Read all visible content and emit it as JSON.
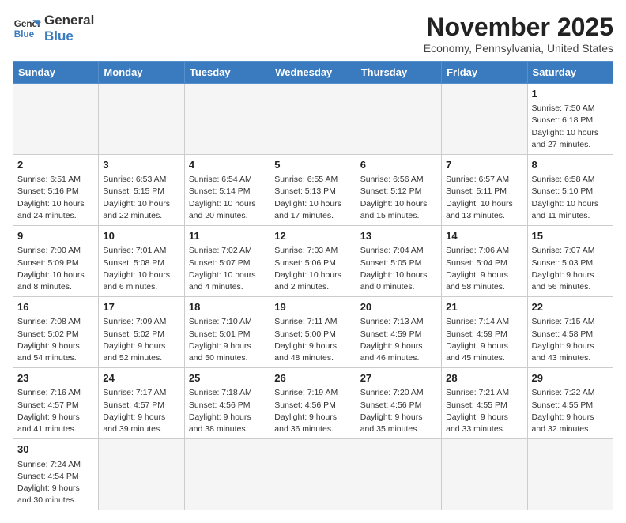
{
  "logo": {
    "line1": "General",
    "line2": "Blue"
  },
  "title": "November 2025",
  "subtitle": "Economy, Pennsylvania, United States",
  "days_of_week": [
    "Sunday",
    "Monday",
    "Tuesday",
    "Wednesday",
    "Thursday",
    "Friday",
    "Saturday"
  ],
  "weeks": [
    [
      {
        "day": "",
        "info": ""
      },
      {
        "day": "",
        "info": ""
      },
      {
        "day": "",
        "info": ""
      },
      {
        "day": "",
        "info": ""
      },
      {
        "day": "",
        "info": ""
      },
      {
        "day": "",
        "info": ""
      },
      {
        "day": "1",
        "info": "Sunrise: 7:50 AM\nSunset: 6:18 PM\nDaylight: 10 hours and 27 minutes."
      }
    ],
    [
      {
        "day": "2",
        "info": "Sunrise: 6:51 AM\nSunset: 5:16 PM\nDaylight: 10 hours and 24 minutes."
      },
      {
        "day": "3",
        "info": "Sunrise: 6:53 AM\nSunset: 5:15 PM\nDaylight: 10 hours and 22 minutes."
      },
      {
        "day": "4",
        "info": "Sunrise: 6:54 AM\nSunset: 5:14 PM\nDaylight: 10 hours and 20 minutes."
      },
      {
        "day": "5",
        "info": "Sunrise: 6:55 AM\nSunset: 5:13 PM\nDaylight: 10 hours and 17 minutes."
      },
      {
        "day": "6",
        "info": "Sunrise: 6:56 AM\nSunset: 5:12 PM\nDaylight: 10 hours and 15 minutes."
      },
      {
        "day": "7",
        "info": "Sunrise: 6:57 AM\nSunset: 5:11 PM\nDaylight: 10 hours and 13 minutes."
      },
      {
        "day": "8",
        "info": "Sunrise: 6:58 AM\nSunset: 5:10 PM\nDaylight: 10 hours and 11 minutes."
      }
    ],
    [
      {
        "day": "9",
        "info": "Sunrise: 7:00 AM\nSunset: 5:09 PM\nDaylight: 10 hours and 8 minutes."
      },
      {
        "day": "10",
        "info": "Sunrise: 7:01 AM\nSunset: 5:08 PM\nDaylight: 10 hours and 6 minutes."
      },
      {
        "day": "11",
        "info": "Sunrise: 7:02 AM\nSunset: 5:07 PM\nDaylight: 10 hours and 4 minutes."
      },
      {
        "day": "12",
        "info": "Sunrise: 7:03 AM\nSunset: 5:06 PM\nDaylight: 10 hours and 2 minutes."
      },
      {
        "day": "13",
        "info": "Sunrise: 7:04 AM\nSunset: 5:05 PM\nDaylight: 10 hours and 0 minutes."
      },
      {
        "day": "14",
        "info": "Sunrise: 7:06 AM\nSunset: 5:04 PM\nDaylight: 9 hours and 58 minutes."
      },
      {
        "day": "15",
        "info": "Sunrise: 7:07 AM\nSunset: 5:03 PM\nDaylight: 9 hours and 56 minutes."
      }
    ],
    [
      {
        "day": "16",
        "info": "Sunrise: 7:08 AM\nSunset: 5:02 PM\nDaylight: 9 hours and 54 minutes."
      },
      {
        "day": "17",
        "info": "Sunrise: 7:09 AM\nSunset: 5:02 PM\nDaylight: 9 hours and 52 minutes."
      },
      {
        "day": "18",
        "info": "Sunrise: 7:10 AM\nSunset: 5:01 PM\nDaylight: 9 hours and 50 minutes."
      },
      {
        "day": "19",
        "info": "Sunrise: 7:11 AM\nSunset: 5:00 PM\nDaylight: 9 hours and 48 minutes."
      },
      {
        "day": "20",
        "info": "Sunrise: 7:13 AM\nSunset: 4:59 PM\nDaylight: 9 hours and 46 minutes."
      },
      {
        "day": "21",
        "info": "Sunrise: 7:14 AM\nSunset: 4:59 PM\nDaylight: 9 hours and 45 minutes."
      },
      {
        "day": "22",
        "info": "Sunrise: 7:15 AM\nSunset: 4:58 PM\nDaylight: 9 hours and 43 minutes."
      }
    ],
    [
      {
        "day": "23",
        "info": "Sunrise: 7:16 AM\nSunset: 4:57 PM\nDaylight: 9 hours and 41 minutes."
      },
      {
        "day": "24",
        "info": "Sunrise: 7:17 AM\nSunset: 4:57 PM\nDaylight: 9 hours and 39 minutes."
      },
      {
        "day": "25",
        "info": "Sunrise: 7:18 AM\nSunset: 4:56 PM\nDaylight: 9 hours and 38 minutes."
      },
      {
        "day": "26",
        "info": "Sunrise: 7:19 AM\nSunset: 4:56 PM\nDaylight: 9 hours and 36 minutes."
      },
      {
        "day": "27",
        "info": "Sunrise: 7:20 AM\nSunset: 4:56 PM\nDaylight: 9 hours and 35 minutes."
      },
      {
        "day": "28",
        "info": "Sunrise: 7:21 AM\nSunset: 4:55 PM\nDaylight: 9 hours and 33 minutes."
      },
      {
        "day": "29",
        "info": "Sunrise: 7:22 AM\nSunset: 4:55 PM\nDaylight: 9 hours and 32 minutes."
      }
    ],
    [
      {
        "day": "30",
        "info": "Sunrise: 7:24 AM\nSunset: 4:54 PM\nDaylight: 9 hours and 30 minutes."
      },
      {
        "day": "",
        "info": ""
      },
      {
        "day": "",
        "info": ""
      },
      {
        "day": "",
        "info": ""
      },
      {
        "day": "",
        "info": ""
      },
      {
        "day": "",
        "info": ""
      },
      {
        "day": "",
        "info": ""
      }
    ]
  ]
}
